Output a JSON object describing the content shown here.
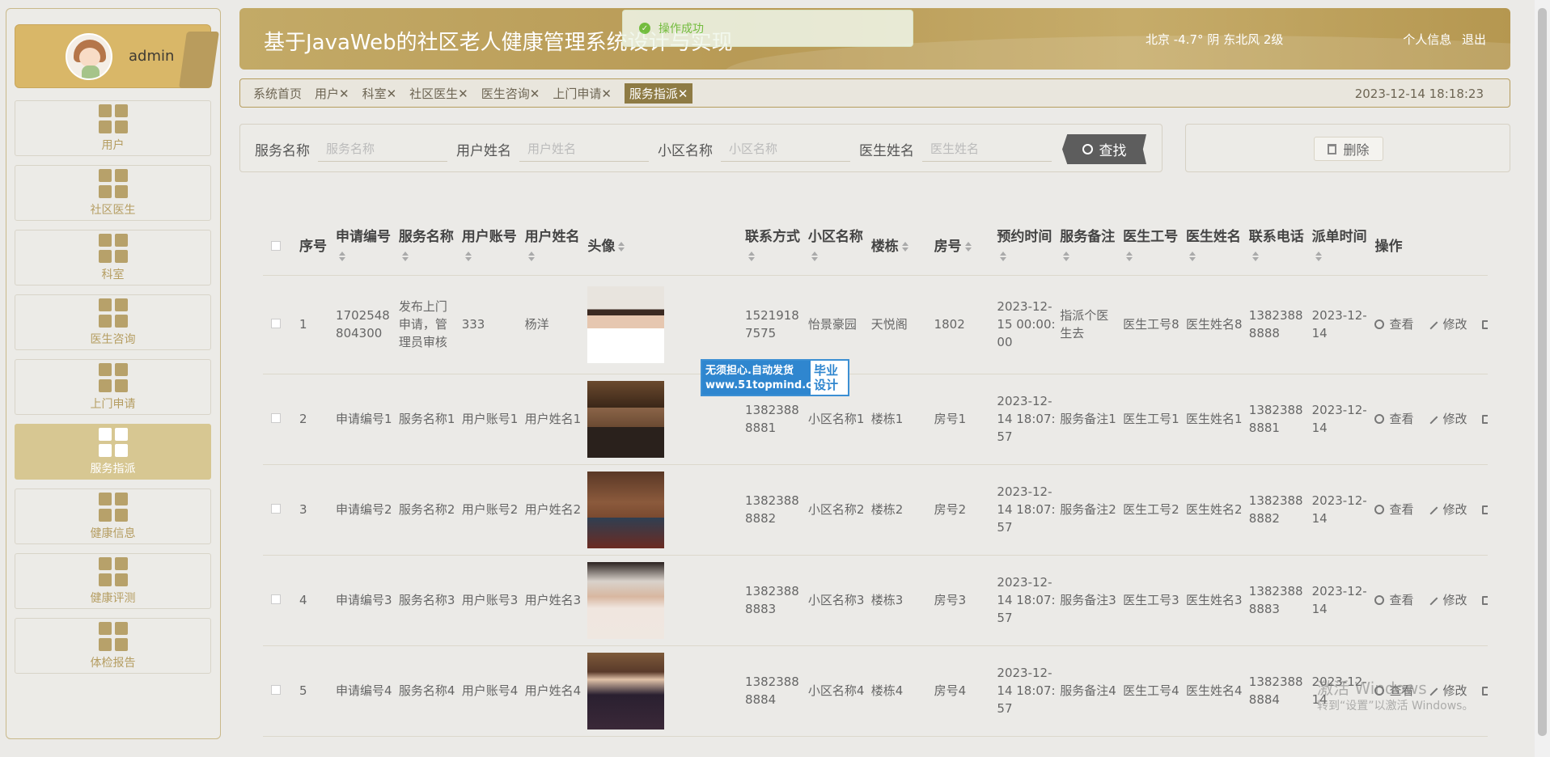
{
  "sidebar": {
    "profile_name": "admin",
    "items": [
      {
        "label": "用户",
        "icon": "grid-icon"
      },
      {
        "label": "社区医生",
        "icon": "grid-icon"
      },
      {
        "label": "科室",
        "icon": "clipboard-icon"
      },
      {
        "label": "医生咨询",
        "icon": "briefcase-icon"
      },
      {
        "label": "上门申请",
        "icon": "grid-icon"
      },
      {
        "label": "服务指派",
        "icon": "book-icon",
        "active": true
      },
      {
        "label": "健康信息",
        "icon": "bar-chart-icon"
      },
      {
        "label": "健康评测",
        "icon": "wallet-icon"
      },
      {
        "label": "体检报告",
        "icon": "grid-icon"
      }
    ]
  },
  "header": {
    "title": "基于JavaWeb的社区老人健康管理系统设计与实现",
    "weather": "北京  -4.7°  阴  东北风  2级",
    "profile_link": "个人信息",
    "logout_link": "退出"
  },
  "toast": {
    "message": "操作成功"
  },
  "tabs": {
    "items": [
      "系统首页",
      "用户✕",
      "科室✕",
      "社区医生✕",
      "医生咨询✕",
      "上门申请✕",
      "服务指派✕"
    ],
    "datetime": "2023-12-14 18:18:23"
  },
  "search": {
    "service_label": "服务名称",
    "service_placeholder": "服务名称",
    "user_label": "用户姓名",
    "user_placeholder": "用户姓名",
    "community_label": "小区名称",
    "community_placeholder": "小区名称",
    "doctor_label": "医生姓名",
    "doctor_placeholder": "医生姓名",
    "find_button": "查找",
    "delete_button": "删除"
  },
  "table": {
    "headers": [
      "序号",
      "申请编号",
      "服务名称",
      "用户账号",
      "用户姓名",
      "头像",
      "联系方式",
      "小区名称",
      "楼栋",
      "房号",
      "预约时间",
      "服务备注",
      "医生工号",
      "医生姓名",
      "联系电话",
      "派单时间",
      "操作"
    ],
    "view_label": "查看",
    "edit_label": "修改",
    "rows": [
      {
        "no": "1",
        "app_no": "1702548804300",
        "service": "发布上门申请，管理员审核",
        "account": "333",
        "name": "杨洋",
        "phone": "15219187575",
        "community": "怡景豪园",
        "building": "天悦阁",
        "room": "1802",
        "appoint": "2023-12-15 00:00:00",
        "remark": "指派个医生去",
        "doc_id": "医生工号8",
        "doc_name": "医生姓名8",
        "doc_phone": "13823888888",
        "dispatch": "2023-12-14"
      },
      {
        "no": "2",
        "app_no": "申请编号1",
        "service": "服务名称1",
        "account": "用户账号1",
        "name": "用户姓名1",
        "phone": "13823888881",
        "community": "小区名称1",
        "building": "楼栋1",
        "room": "房号1",
        "appoint": "2023-12-14 18:07:57",
        "remark": "服务备注1",
        "doc_id": "医生工号1",
        "doc_name": "医生姓名1",
        "doc_phone": "13823888881",
        "dispatch": "2023-12-14"
      },
      {
        "no": "3",
        "app_no": "申请编号2",
        "service": "服务名称2",
        "account": "用户账号2",
        "name": "用户姓名2",
        "phone": "13823888882",
        "community": "小区名称2",
        "building": "楼栋2",
        "room": "房号2",
        "appoint": "2023-12-14 18:07:57",
        "remark": "服务备注2",
        "doc_id": "医生工号2",
        "doc_name": "医生姓名2",
        "doc_phone": "13823888882",
        "dispatch": "2023-12-14"
      },
      {
        "no": "4",
        "app_no": "申请编号3",
        "service": "服务名称3",
        "account": "用户账号3",
        "name": "用户姓名3",
        "phone": "13823888883",
        "community": "小区名称3",
        "building": "楼栋3",
        "room": "房号3",
        "appoint": "2023-12-14 18:07:57",
        "remark": "服务备注3",
        "doc_id": "医生工号3",
        "doc_name": "医生姓名3",
        "doc_phone": "13823888883",
        "dispatch": "2023-12-14"
      },
      {
        "no": "5",
        "app_no": "申请编号4",
        "service": "服务名称4",
        "account": "用户账号4",
        "name": "用户姓名4",
        "phone": "13823888884",
        "community": "小区名称4",
        "building": "楼栋4",
        "room": "房号4",
        "appoint": "2023-12-14 18:07:57",
        "remark": "服务备注4",
        "doc_id": "医生工号4",
        "doc_name": "医生姓名4",
        "doc_phone": "13823888884",
        "dispatch": "2023-12-14"
      }
    ]
  },
  "watermark": {
    "left_text": "无须担心.自动发货 www.51topmind.com",
    "right_text": "毕业设计"
  },
  "windows_activation": {
    "line1": "激活 Windows",
    "line2": "转到“设置”以激活 Windows。"
  }
}
